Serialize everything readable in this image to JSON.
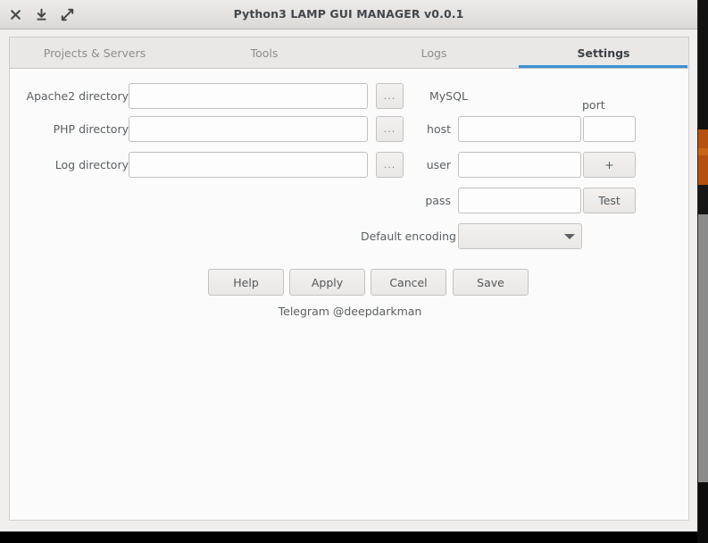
{
  "window": {
    "title": "Python3 LAMP GUI MANAGER v0.0.1",
    "controls": {
      "close": "close-icon",
      "minimize": "minimize-icon",
      "maximize": "maximize-icon"
    },
    "accent_color": "#3b8fd8",
    "titlebar_color": "#e6e4e2",
    "panel_color": "#fbfbfb"
  },
  "tabs": [
    {
      "label": "Projects & Servers",
      "active": false
    },
    {
      "label": "Tools",
      "active": false
    },
    {
      "label": "Logs",
      "active": false
    },
    {
      "label": "Settings",
      "active": true
    }
  ],
  "settings": {
    "directories": [
      {
        "label": "Apache2 directory",
        "value": "",
        "placeholder": "",
        "browse_label": "..."
      },
      {
        "label": "PHP directory",
        "value": "",
        "placeholder": "",
        "browse_label": "..."
      },
      {
        "label": "Log directory",
        "value": "",
        "placeholder": "",
        "browse_label": "..."
      }
    ],
    "mysql": {
      "group_label": "MySQL",
      "port_label": "port",
      "host_label": "host",
      "host_value": "",
      "port_value": "",
      "user_label": "user",
      "user_value": "",
      "add_label": "+",
      "pass_label": "pass",
      "pass_value": "",
      "test_label": "Test"
    },
    "encoding": {
      "label": "Default encoding",
      "value": ""
    },
    "actions": {
      "help": "Help",
      "apply": "Apply",
      "cancel": "Cancel",
      "save": "Save"
    },
    "footnote": "Telegram @deepdarkman"
  }
}
